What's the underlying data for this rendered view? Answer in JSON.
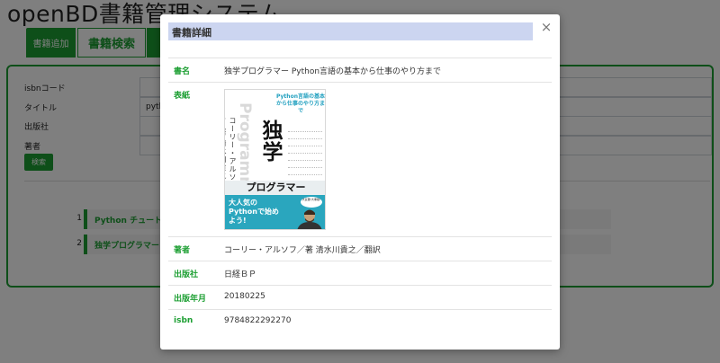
{
  "app": {
    "title": "openBD書籍管理システム",
    "tabs": {
      "add": "書籍追加",
      "search": "書籍検索",
      "extra": ""
    }
  },
  "search_form": {
    "fields": [
      {
        "label": "isbnコード",
        "value": ""
      },
      {
        "label": "タイトル",
        "value": "pytho"
      },
      {
        "label": "出版社",
        "value": ""
      },
      {
        "label": "著者",
        "value": ""
      }
    ],
    "search_button": "検索"
  },
  "results": [
    {
      "num": "1",
      "title": "Python チュートリ"
    },
    {
      "num": "2",
      "title": "独学プログラマー P"
    }
  ],
  "modal": {
    "title": "書籍詳細",
    "close_glyph": "×",
    "rows": {
      "title": {
        "label": "書名",
        "value": "独学プログラマー Python言語の基本から仕事のやり方まで"
      },
      "cover": {
        "label": "表紙"
      },
      "author": {
        "label": "著者",
        "value": "コーリー・アルソフ／著 清水川貴之／翻訳"
      },
      "publisher": {
        "label": "出版社",
        "value": "日経ＢＰ"
      },
      "pubdate": {
        "label": "出版年月",
        "value": "20180225"
      },
      "isbn": {
        "label": "isbn",
        "value": "9784822292270"
      }
    }
  },
  "cover_art": {
    "tagline": "Python言語の基本から仕事のやり方まで",
    "vertical_author": "コーリー・アルソフ 著 清水川貴之",
    "watermark": "Programmer",
    "big_title": "独学",
    "katakana": "プログラマー",
    "bottom_text": "大人気のPythonで始めよう!",
    "badge": "大反響!大重版!"
  },
  "colors": {
    "accent": "#1d9f33",
    "modal_title_bg": "#ccd5f0",
    "cover_teal": "#2aa6be"
  }
}
